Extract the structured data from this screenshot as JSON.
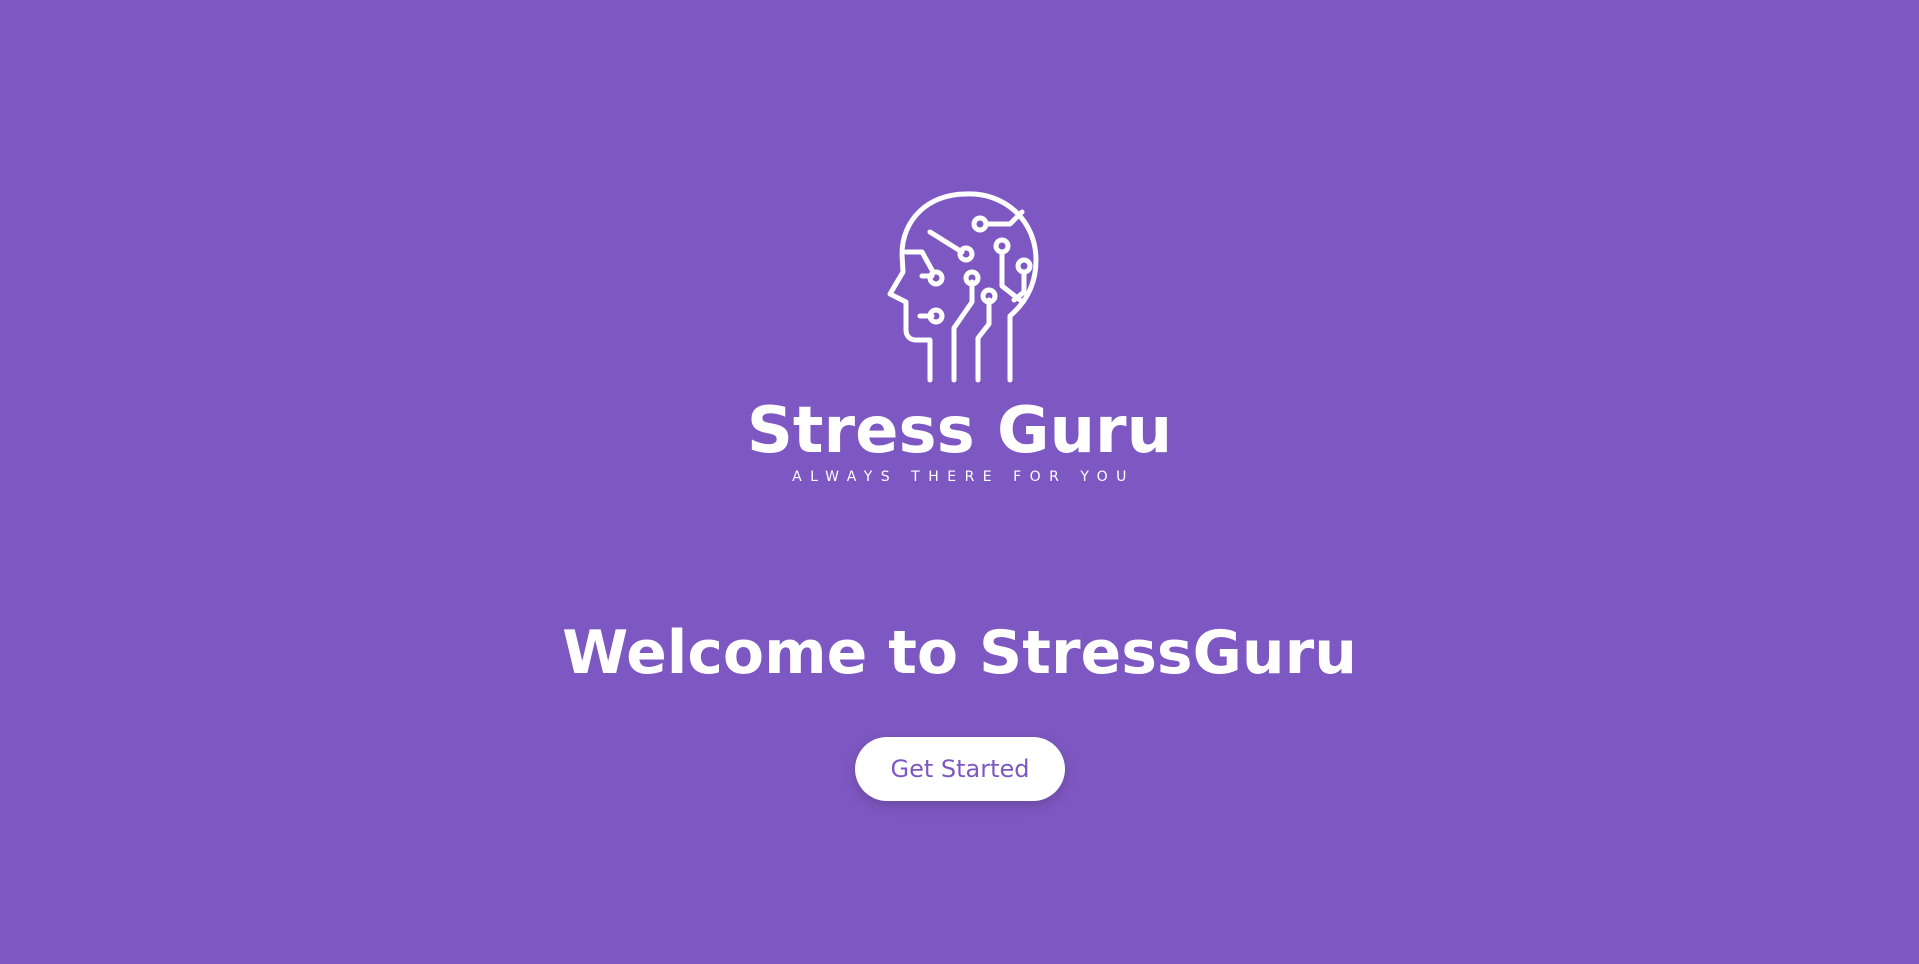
{
  "theme": {
    "background": "#7e58c2",
    "foreground": "#ffffff",
    "button_text": "#7e58c2"
  },
  "logo": {
    "icon": "head-circuit-icon",
    "name": "Stress Guru",
    "tagline": "ALWAYS THERE FOR YOU"
  },
  "hero": {
    "title": "Welcome to StressGuru",
    "cta_label": "Get Started"
  }
}
